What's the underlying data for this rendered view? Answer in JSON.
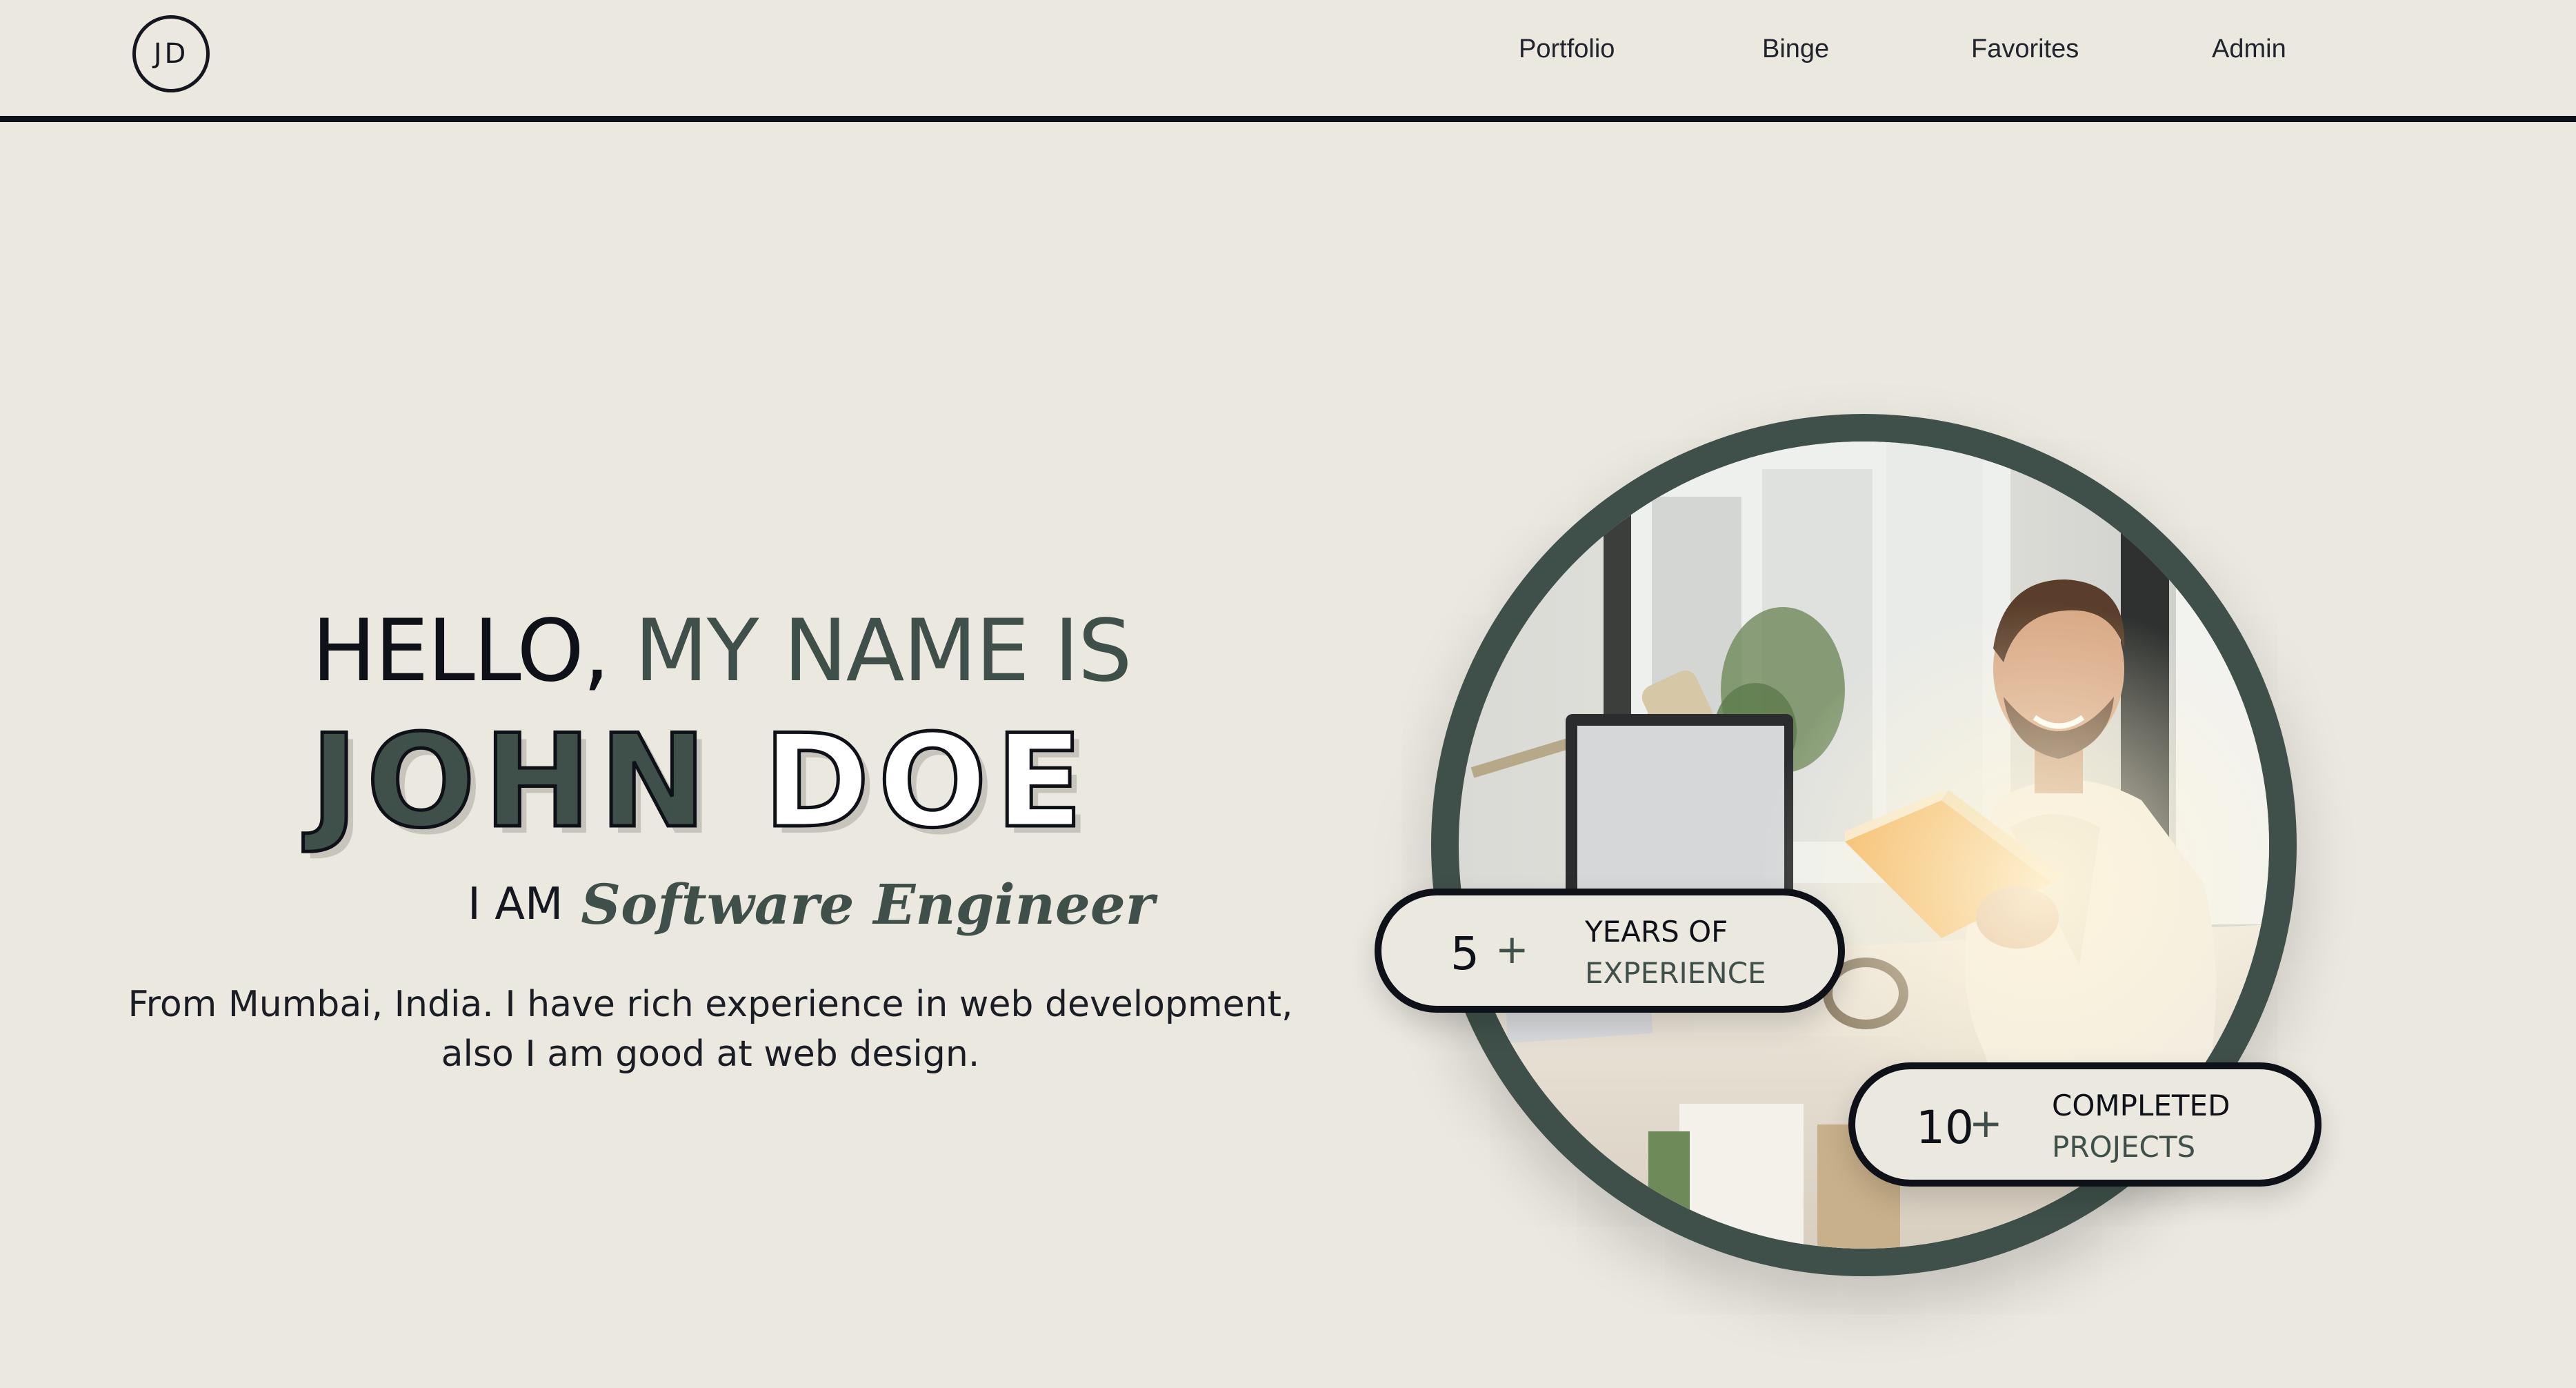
{
  "header": {
    "logo": "JD",
    "nav": [
      {
        "label": "Portfolio"
      },
      {
        "label": "Binge"
      },
      {
        "label": "Favorites"
      },
      {
        "label": "Admin"
      }
    ]
  },
  "hero": {
    "greeting_part1": "HELLO,",
    "greeting_part2": "MY NAME IS",
    "first_name": "JOHN",
    "last_name": "DOE",
    "role_prefix": "I AM",
    "role": "Software Engineer",
    "description_line1": "From Mumbai, India. I have rich experience in web development,",
    "description_line2": "also I am good at web design."
  },
  "stats": [
    {
      "number": "5",
      "plus": "+",
      "line1": "YEARS OF",
      "line2": "EXPERIENCE"
    },
    {
      "number": "10",
      "plus": "+",
      "line1": "COMPLETED",
      "line2": "PROJECTS"
    }
  ],
  "colors": {
    "background": "#ebe8e0",
    "accent_green": "#3e5049",
    "ink": "#0f1118"
  }
}
